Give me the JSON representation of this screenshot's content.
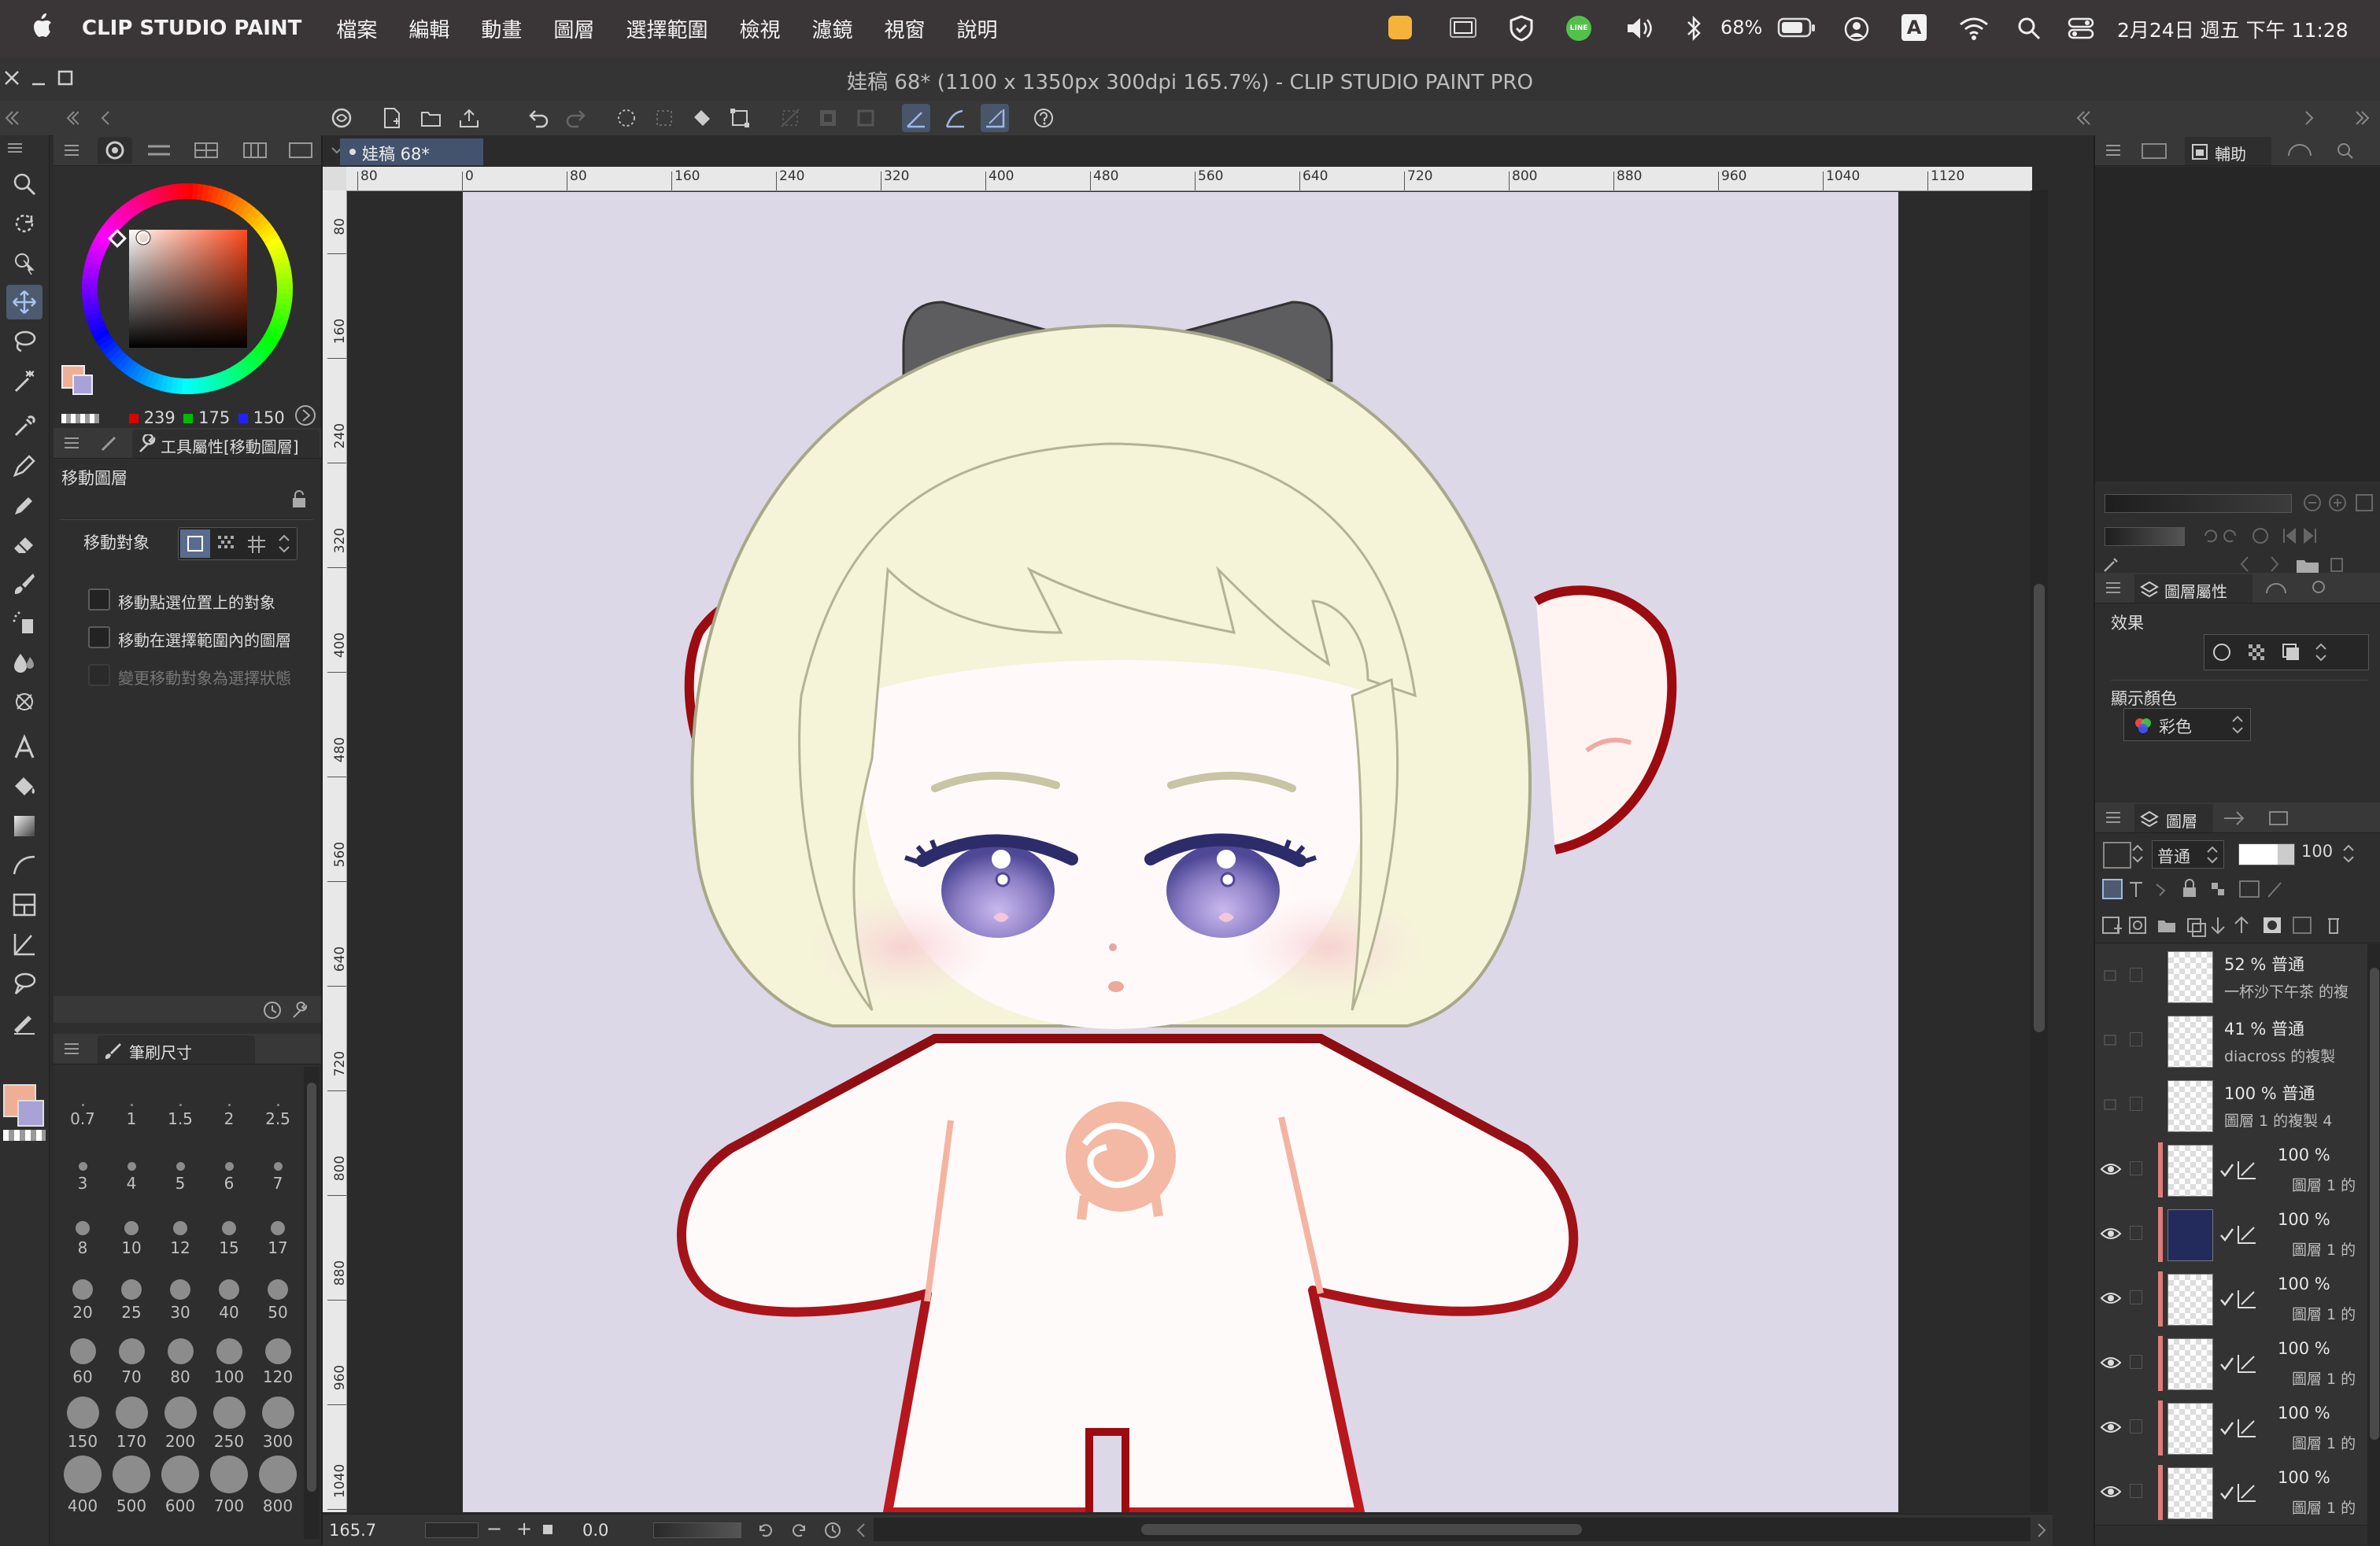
{
  "menubar": {
    "app_name": "CLIP STUDIO PAINT",
    "menus": [
      "檔案",
      "編輯",
      "動畫",
      "圖層",
      "選擇範圍",
      "檢視",
      "濾鏡",
      "視窗",
      "說明"
    ],
    "battery": "68%",
    "input_method": "A",
    "datetime": "2月24日 週五 下午 11:28"
  },
  "window": {
    "title": "娃稿 68* (1100 x 1350px 300dpi 165.7%)  - CLIP STUDIO PAINT PRO",
    "doc_tab": "娃稿 68*"
  },
  "color_panel": {
    "r": "239",
    "g": "175",
    "b": "150",
    "main_color": "#efaf96",
    "sub_color": "#a9a2d6"
  },
  "tool_property": {
    "header": "工具屬性[移動圖層]",
    "tool_name": "移動圖層",
    "move_target_label": "移動對象",
    "options": [
      "移動點選位置上的對象",
      "移動在選擇範圍內的圖層",
      "變更移動對象為選擇狀態"
    ]
  },
  "brush_size": {
    "header": "筆刷尺寸",
    "sizes": [
      "0.7",
      "1",
      "1.5",
      "2",
      "2.5",
      "3",
      "4",
      "5",
      "6",
      "7",
      "8",
      "10",
      "12",
      "15",
      "17",
      "20",
      "25",
      "30",
      "40",
      "50",
      "60",
      "70",
      "80",
      "100",
      "120",
      "150",
      "170",
      "200",
      "250",
      "300",
      "400",
      "500",
      "600",
      "700",
      "800"
    ]
  },
  "ruler": {
    "h_ticks": [
      "80",
      "0",
      "80",
      "160",
      "240",
      "320",
      "400",
      "480",
      "560",
      "640",
      "720",
      "800",
      "880",
      "960",
      "1040",
      "1120",
      "120"
    ],
    "v_ticks": [
      "80",
      "160",
      "240",
      "320",
      "400",
      "480",
      "560",
      "640",
      "720",
      "800",
      "880",
      "960",
      "1040"
    ]
  },
  "status": {
    "zoom": "165.7",
    "rotation": "0.0"
  },
  "right_panels": {
    "sub_tab": "輔助",
    "layer_property_header": "圖層屬性",
    "effect_label": "效果",
    "display_color_label": "顯示顏色",
    "display_color_value": "彩色",
    "layer_header": "圖層",
    "blend_mode": "普通",
    "opacity": "100"
  },
  "layers": [
    {
      "opacity": "52 % 普通",
      "name": "一杯沙下午茶 的複"
    },
    {
      "opacity": "41 % 普通",
      "name": "diacross 的複製"
    },
    {
      "opacity": "100 % 普通",
      "name": "圖層 1 的複製 4"
    },
    {
      "opacity": "100 %",
      "name": "圖層 1 的"
    },
    {
      "opacity": "100 %",
      "name": "圖層 1 的"
    },
    {
      "opacity": "100 %",
      "name": "圖層 1 的"
    },
    {
      "opacity": "100 %",
      "name": "圖層 1 的"
    },
    {
      "opacity": "100 %",
      "name": "圖層 1 的"
    },
    {
      "opacity": "100 %",
      "name": "圖層 1 的"
    }
  ]
}
